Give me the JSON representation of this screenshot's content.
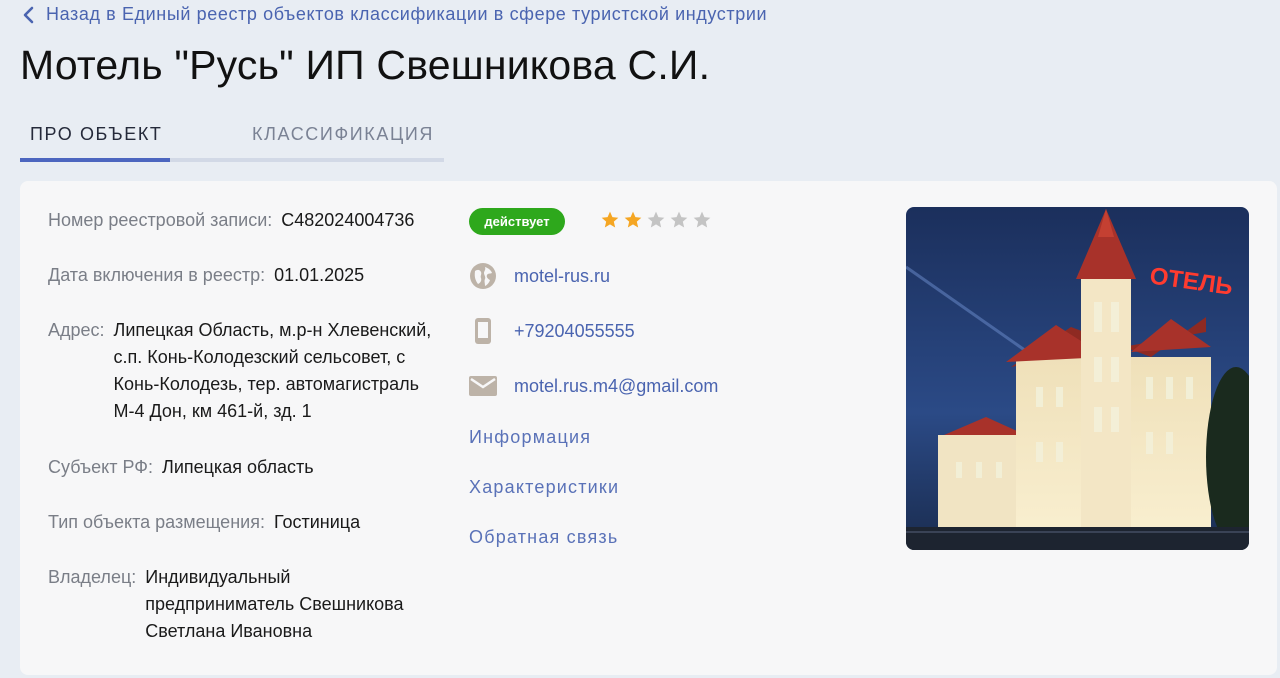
{
  "back_link": {
    "label": "Назад в Единый реестр объектов классификации в сфере туристской индустрии"
  },
  "title": "Мотель \"Русь\" ИП Свешникова С.И.",
  "tabs": [
    {
      "label": "Про объект",
      "active": true
    },
    {
      "label": "Классификация",
      "active": false
    }
  ],
  "details": {
    "registry_number": {
      "label": "Номер реестровой записи:",
      "value": "С482024004736"
    },
    "inclusion_date": {
      "label": "Дата включения в реестр:",
      "value": "01.01.2025"
    },
    "address": {
      "label": "Адрес:",
      "value": "Липецкая Область, м.р-н Хлевенский, с.п. Конь-Колодезский сельсовет, с Конь-Колодезь, тер. автомагистраль М-4 Дон, км 461-й, зд. 1"
    },
    "subject": {
      "label": "Субъект РФ:",
      "value": "Липецкая область"
    },
    "object_type": {
      "label": "Тип объекта размещения:",
      "value": "Гостиница"
    },
    "owner": {
      "label": "Владелец:",
      "value": "Индивидуальный предприниматель Свешникова Светлана Ивановна"
    }
  },
  "status": {
    "label": "действует",
    "color": "#2ea81c"
  },
  "rating": {
    "stars": 2,
    "max": 5,
    "filled_color": "#f5a623",
    "empty_color": "#c4c4c4"
  },
  "contacts": {
    "website": {
      "icon": "globe-icon",
      "value": "motel-rus.ru"
    },
    "phone": {
      "icon": "phone-icon",
      "value": "+79204055555"
    },
    "email": {
      "icon": "mail-icon",
      "value": "motel.rus.m4@gmail.com"
    }
  },
  "section_links": [
    "Информация",
    "Характеристики",
    "Обратная связь"
  ],
  "photo": {
    "sign_text": "ОТЕЛЬ"
  }
}
